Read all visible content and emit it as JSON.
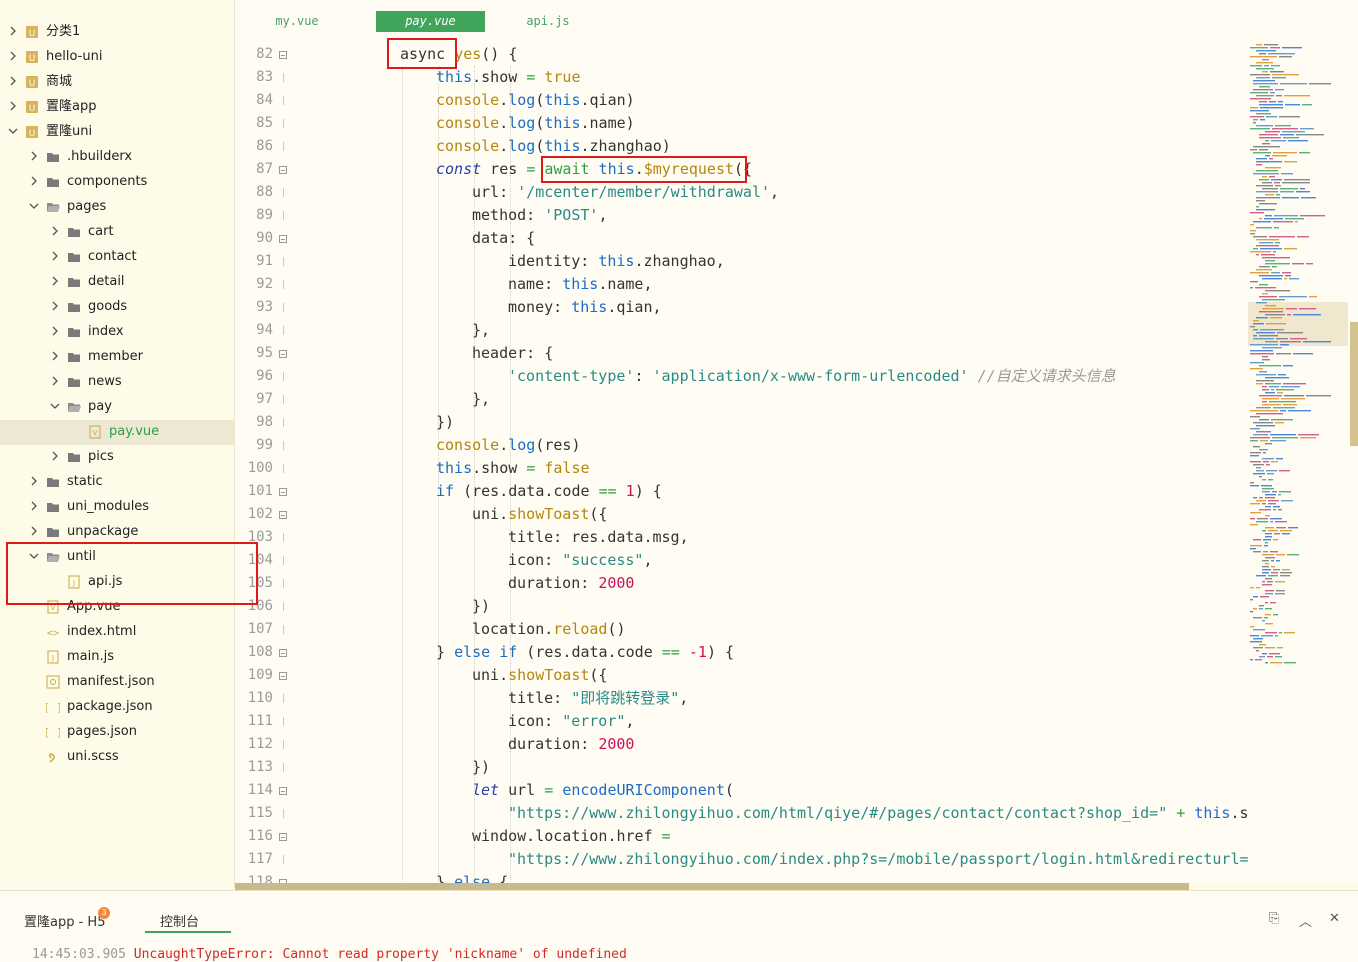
{
  "sidebar": {
    "items": [
      {
        "label": "分类1",
        "icon": "project-icon",
        "expanded": false
      },
      {
        "label": "hello-uni",
        "icon": "project-icon",
        "expanded": false
      },
      {
        "label": "商城",
        "icon": "project-icon",
        "expanded": false
      },
      {
        "label": "置隆app",
        "icon": "project-icon",
        "expanded": false
      },
      {
        "label": "置隆uni",
        "icon": "project-icon",
        "expanded": true
      },
      {
        "label": ".hbuilderx",
        "icon": "folder-icon",
        "expanded": false
      },
      {
        "label": "components",
        "icon": "folder-icon",
        "expanded": false
      },
      {
        "label": "pages",
        "icon": "folder-open-icon",
        "expanded": true
      },
      {
        "label": "cart",
        "icon": "folder-icon",
        "expanded": false
      },
      {
        "label": "contact",
        "icon": "folder-icon",
        "expanded": false
      },
      {
        "label": "detail",
        "icon": "folder-icon",
        "expanded": false
      },
      {
        "label": "goods",
        "icon": "folder-icon",
        "expanded": false
      },
      {
        "label": "index",
        "icon": "folder-icon",
        "expanded": false
      },
      {
        "label": "member",
        "icon": "folder-icon",
        "expanded": false
      },
      {
        "label": "news",
        "icon": "folder-icon",
        "expanded": false
      },
      {
        "label": "pay",
        "icon": "folder-open-icon",
        "expanded": true
      },
      {
        "label": "pay.vue",
        "icon": "vue-file-icon",
        "expanded": null
      },
      {
        "label": "pics",
        "icon": "folder-icon",
        "expanded": false
      },
      {
        "label": "static",
        "icon": "folder-icon",
        "expanded": false
      },
      {
        "label": "uni_modules",
        "icon": "folder-icon",
        "expanded": false
      },
      {
        "label": "unpackage",
        "icon": "folder-icon",
        "expanded": false
      },
      {
        "label": "until",
        "icon": "folder-open-icon",
        "expanded": true
      },
      {
        "label": "api.js",
        "icon": "js-file-icon",
        "expanded": null
      },
      {
        "label": "App.vue",
        "icon": "vue-file-icon",
        "expanded": null
      },
      {
        "label": "index.html",
        "icon": "html-file-icon",
        "expanded": null
      },
      {
        "label": "main.js",
        "icon": "js-file-icon",
        "expanded": null
      },
      {
        "label": "manifest.json",
        "icon": "manifest-file-icon",
        "expanded": null
      },
      {
        "label": "package.json",
        "icon": "json-file-icon",
        "expanded": null
      },
      {
        "label": "pages.json",
        "icon": "json-file-icon",
        "expanded": null
      },
      {
        "label": "uni.scss",
        "icon": "scss-file-icon",
        "expanded": null
      }
    ],
    "selected": "pay.vue"
  },
  "tabs": [
    {
      "label": "my.vue",
      "active": false
    },
    {
      "label": "pay.vue",
      "active": true
    },
    {
      "label": "api.js",
      "active": false
    }
  ],
  "editor": {
    "lines": [
      {
        "n": 82,
        "fold": true,
        "indent": 0,
        "tokens": [
          [
            "p",
            "async "
          ],
          [
            "m",
            "yes"
          ],
          [
            "p",
            "() {"
          ]
        ]
      },
      {
        "n": 83,
        "fold": false,
        "indent": 1,
        "tokens": [
          [
            "k",
            "this"
          ],
          [
            "p",
            ".show "
          ],
          [
            "v",
            "="
          ],
          [
            "p",
            " "
          ],
          [
            "fy",
            "true"
          ]
        ]
      },
      {
        "n": 84,
        "fold": false,
        "indent": 1,
        "tokens": [
          [
            "fy",
            "console"
          ],
          [
            "p",
            "."
          ],
          [
            "f",
            "log"
          ],
          [
            "p",
            "("
          ],
          [
            "k",
            "this"
          ],
          [
            "p",
            ".qian)"
          ]
        ]
      },
      {
        "n": 85,
        "fold": false,
        "indent": 1,
        "tokens": [
          [
            "fy",
            "console"
          ],
          [
            "p",
            "."
          ],
          [
            "f",
            "log"
          ],
          [
            "p",
            "("
          ],
          [
            "k",
            "this"
          ],
          [
            "p",
            ".name)"
          ]
        ]
      },
      {
        "n": 86,
        "fold": false,
        "indent": 1,
        "tokens": [
          [
            "fy",
            "console"
          ],
          [
            "p",
            "."
          ],
          [
            "f",
            "log"
          ],
          [
            "p",
            "("
          ],
          [
            "k",
            "this"
          ],
          [
            "p",
            ".zhanghao)"
          ]
        ]
      },
      {
        "n": 87,
        "fold": true,
        "indent": 1,
        "tokens": [
          [
            "kb",
            "const"
          ],
          [
            "p",
            " res "
          ],
          [
            "v",
            "="
          ],
          [
            "p",
            " "
          ],
          [
            "v",
            "await"
          ],
          [
            "p",
            " "
          ],
          [
            "k",
            "this"
          ],
          [
            "p",
            "."
          ],
          [
            "fy",
            "$myrequest"
          ],
          [
            "p",
            "({"
          ]
        ]
      },
      {
        "n": 88,
        "fold": false,
        "indent": 2,
        "tokens": [
          [
            "p",
            "url: "
          ],
          [
            "s",
            "'/mcenter/member/withdrawal'"
          ],
          [
            "p",
            ","
          ]
        ]
      },
      {
        "n": 89,
        "fold": false,
        "indent": 2,
        "tokens": [
          [
            "p",
            "method: "
          ],
          [
            "s",
            "'POST'"
          ],
          [
            "p",
            ","
          ]
        ]
      },
      {
        "n": 90,
        "fold": true,
        "indent": 2,
        "tokens": [
          [
            "p",
            "data: {"
          ]
        ]
      },
      {
        "n": 91,
        "fold": false,
        "indent": 3,
        "tokens": [
          [
            "p",
            "identity: "
          ],
          [
            "k",
            "this"
          ],
          [
            "p",
            ".zhanghao,"
          ]
        ]
      },
      {
        "n": 92,
        "fold": false,
        "indent": 3,
        "tokens": [
          [
            "p",
            "name: "
          ],
          [
            "k",
            "this"
          ],
          [
            "p",
            ".name,"
          ]
        ]
      },
      {
        "n": 93,
        "fold": false,
        "indent": 3,
        "tokens": [
          [
            "p",
            "money: "
          ],
          [
            "k",
            "this"
          ],
          [
            "p",
            ".qian,"
          ]
        ]
      },
      {
        "n": 94,
        "fold": false,
        "indent": 2,
        "tokens": [
          [
            "p",
            "},"
          ]
        ]
      },
      {
        "n": 95,
        "fold": true,
        "indent": 2,
        "tokens": [
          [
            "p",
            "header: {"
          ]
        ]
      },
      {
        "n": 96,
        "fold": false,
        "indent": 3,
        "tokens": [
          [
            "s",
            "'content-type'"
          ],
          [
            "p",
            ": "
          ],
          [
            "s",
            "'application/x-www-form-urlencoded'"
          ],
          [
            "p",
            " "
          ],
          [
            "c",
            "//自定义请求头信息"
          ]
        ]
      },
      {
        "n": 97,
        "fold": false,
        "indent": 2,
        "tokens": [
          [
            "p",
            "},"
          ]
        ]
      },
      {
        "n": 98,
        "fold": false,
        "indent": 1,
        "tokens": [
          [
            "p",
            "})"
          ]
        ]
      },
      {
        "n": 99,
        "fold": false,
        "indent": 1,
        "tokens": [
          [
            "fy",
            "console"
          ],
          [
            "p",
            "."
          ],
          [
            "f",
            "log"
          ],
          [
            "p",
            "(res)"
          ]
        ]
      },
      {
        "n": 100,
        "fold": false,
        "indent": 1,
        "tokens": [
          [
            "k",
            "this"
          ],
          [
            "p",
            ".show "
          ],
          [
            "v",
            "="
          ],
          [
            "p",
            " "
          ],
          [
            "fy",
            "false"
          ]
        ]
      },
      {
        "n": 101,
        "fold": true,
        "indent": 1,
        "tokens": [
          [
            "k",
            "if"
          ],
          [
            "p",
            " (res.data.code "
          ],
          [
            "v",
            "=="
          ],
          [
            "p",
            " "
          ],
          [
            "n",
            "1"
          ],
          [
            "p",
            ") {"
          ]
        ]
      },
      {
        "n": 102,
        "fold": true,
        "indent": 2,
        "tokens": [
          [
            "p",
            "uni."
          ],
          [
            "fy",
            "showToast"
          ],
          [
            "p",
            "({"
          ]
        ]
      },
      {
        "n": 103,
        "fold": false,
        "indent": 3,
        "tokens": [
          [
            "p",
            "title: res.data.msg,"
          ]
        ]
      },
      {
        "n": 104,
        "fold": false,
        "indent": 3,
        "tokens": [
          [
            "p",
            "icon: "
          ],
          [
            "s",
            "\"success\""
          ],
          [
            "p",
            ","
          ]
        ]
      },
      {
        "n": 105,
        "fold": false,
        "indent": 3,
        "tokens": [
          [
            "p",
            "duration: "
          ],
          [
            "n",
            "2000"
          ]
        ]
      },
      {
        "n": 106,
        "fold": false,
        "indent": 2,
        "tokens": [
          [
            "p",
            "})"
          ]
        ]
      },
      {
        "n": 107,
        "fold": false,
        "indent": 2,
        "tokens": [
          [
            "p",
            "location."
          ],
          [
            "fy",
            "reload"
          ],
          [
            "p",
            "()"
          ]
        ]
      },
      {
        "n": 108,
        "fold": true,
        "indent": 1,
        "tokens": [
          [
            "p",
            "} "
          ],
          [
            "k",
            "else if"
          ],
          [
            "p",
            " (res.data.code "
          ],
          [
            "v",
            "=="
          ],
          [
            "p",
            " "
          ],
          [
            "n",
            "-1"
          ],
          [
            "p",
            ") {"
          ]
        ]
      },
      {
        "n": 109,
        "fold": true,
        "indent": 2,
        "tokens": [
          [
            "p",
            "uni."
          ],
          [
            "fy",
            "showToast"
          ],
          [
            "p",
            "({"
          ]
        ]
      },
      {
        "n": 110,
        "fold": false,
        "indent": 3,
        "tokens": [
          [
            "p",
            "title: "
          ],
          [
            "s",
            "\"即将跳转登录\""
          ],
          [
            "p",
            ","
          ]
        ]
      },
      {
        "n": 111,
        "fold": false,
        "indent": 3,
        "tokens": [
          [
            "p",
            "icon: "
          ],
          [
            "s",
            "\"error\""
          ],
          [
            "p",
            ","
          ]
        ]
      },
      {
        "n": 112,
        "fold": false,
        "indent": 3,
        "tokens": [
          [
            "p",
            "duration: "
          ],
          [
            "n",
            "2000"
          ]
        ]
      },
      {
        "n": 113,
        "fold": false,
        "indent": 2,
        "tokens": [
          [
            "p",
            "})"
          ]
        ]
      },
      {
        "n": 114,
        "fold": true,
        "indent": 2,
        "tokens": [
          [
            "kb",
            "let"
          ],
          [
            "p",
            " url "
          ],
          [
            "v",
            "="
          ],
          [
            "p",
            " "
          ],
          [
            "f",
            "encodeURIComponent"
          ],
          [
            "p",
            "("
          ]
        ]
      },
      {
        "n": 115,
        "fold": false,
        "indent": 3,
        "tokens": [
          [
            "s",
            "\"https://www.zhilongyihuo.com/html/qiye/#/pages/contact/contact?shop_id=\""
          ],
          [
            "p",
            " "
          ],
          [
            "v",
            "+"
          ],
          [
            "p",
            " "
          ],
          [
            "k",
            "this"
          ],
          [
            "p",
            ".sh"
          ]
        ]
      },
      {
        "n": 116,
        "fold": true,
        "indent": 2,
        "tokens": [
          [
            "p",
            "window.location.href "
          ],
          [
            "v",
            "="
          ]
        ]
      },
      {
        "n": 117,
        "fold": false,
        "indent": 3,
        "tokens": [
          [
            "s",
            "\"https://www.zhilongyihuo.com/index.php?s=/mobile/passport/login.html&redirecturl=\""
          ]
        ]
      },
      {
        "n": 118,
        "fold": true,
        "indent": 1,
        "tokens": [
          [
            "p",
            "} "
          ],
          [
            "k",
            "else"
          ],
          [
            "p",
            " {"
          ]
        ]
      }
    ]
  },
  "panel": {
    "run_label": "置隆app - H5",
    "badge": "3",
    "console_label": "控制台",
    "log_time": "14:45:03.905",
    "log_error": "UncaughtTypeError: Cannot read property 'nickname' of undefined"
  },
  "colors": {
    "accent": "#40a55b",
    "annotation": "#e01919",
    "background": "#fffdf3"
  }
}
